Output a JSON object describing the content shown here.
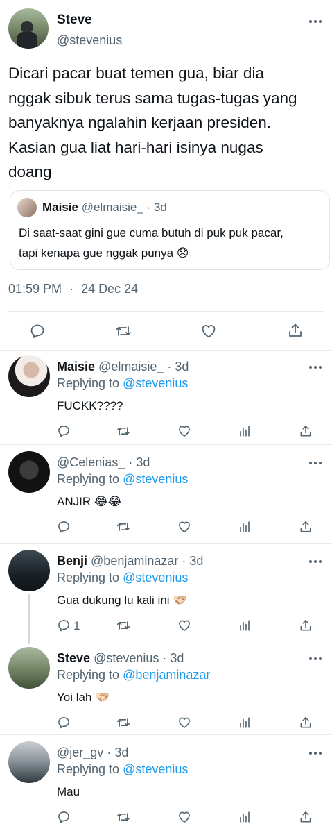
{
  "main_tweet": {
    "name": "Steve",
    "handle": "@stevenius",
    "text_lines": [
      "Dicari pacar buat temen gua, biar dia",
      "nggak sibuk terus sama tugas-tugas yang",
      "banyaknya ngalahin kerjaan presiden.",
      "Kasian gua liat hari-hari isinya nugas",
      "doang"
    ],
    "quote": {
      "name": "Maisie",
      "handle": "@elmaisie_",
      "time": "3d",
      "line1": "Di saat-saat gini gue cuma butuh di puk puk pacar,",
      "line2": "tapi kenapa gue nggak punya 😞"
    },
    "time": "01:59 PM",
    "date": "24 Dec 24"
  },
  "replies": [
    {
      "name": "Maisie",
      "handle": "@elmaisie_",
      "time": "3d",
      "replying_prefix": "Replying to",
      "replying_to": "@stevenius",
      "text": "FUCKK????",
      "reply_count": ""
    },
    {
      "name": "",
      "handle": "@Celenias_",
      "time": "3d",
      "replying_prefix": "Replying to",
      "replying_to": "@stevenius",
      "text": "ANJIR 😂😂",
      "reply_count": ""
    },
    {
      "name": "Benji",
      "handle": "@benjaminazar",
      "time": "3d",
      "replying_prefix": "Replying to",
      "replying_to": "@stevenius",
      "text": "Gua dukung lu kali ini 🫱🏻‍🫲🏼",
      "reply_count": "1"
    },
    {
      "name": "Steve",
      "handle": "@stevenius",
      "time": "3d",
      "replying_prefix": "Replying to",
      "replying_to": "@benjaminazar",
      "text": "Yoi lah 🫱🏻‍🫲🏼",
      "reply_count": ""
    },
    {
      "name": "",
      "handle": "@jer_gv",
      "time": "3d",
      "replying_prefix": "Replying to",
      "replying_to": "@stevenius",
      "text": "Mau",
      "reply_count": ""
    }
  ],
  "icons": {
    "reply": "reply-icon",
    "retweet": "retweet-icon",
    "like": "like-icon",
    "share": "share-icon",
    "views": "views-icon",
    "more": "more-icon"
  },
  "colors": {
    "link": "#1d9bf0",
    "muted": "#536471",
    "text": "#0f1419",
    "divider": "#e6e9ec"
  }
}
